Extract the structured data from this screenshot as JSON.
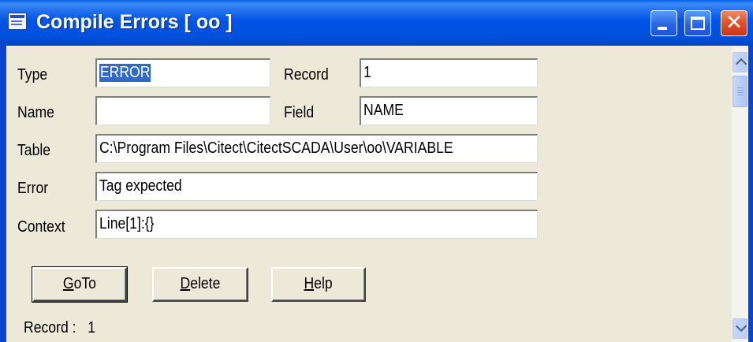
{
  "window": {
    "title": "Compile Errors [ oo ]",
    "icon": "app-window-icon"
  },
  "form": {
    "type_label": "Type",
    "type_value": "ERROR",
    "record_label": "Record",
    "record_value": "1",
    "name_label": "Name",
    "name_value": "",
    "field_label": "Field",
    "field_value": "NAME",
    "table_label": "Table",
    "table_value": "C:\\Program Files\\Citect\\CitectSCADA\\User\\oo\\VARIABLE",
    "error_label": "Error",
    "error_value": "Tag expected",
    "context_label": "Context",
    "context_value": "Line[1]:{}"
  },
  "buttons": {
    "goto_first": "G",
    "goto_rest": "oTo",
    "delete_first": "D",
    "delete_rest": "elete",
    "help_first": "H",
    "help_rest": "elp"
  },
  "status": {
    "label": "Record :",
    "value": "1"
  },
  "colors": {
    "titlebar": "#0055e5",
    "close": "#e0502a",
    "selection": "#316ac5"
  }
}
